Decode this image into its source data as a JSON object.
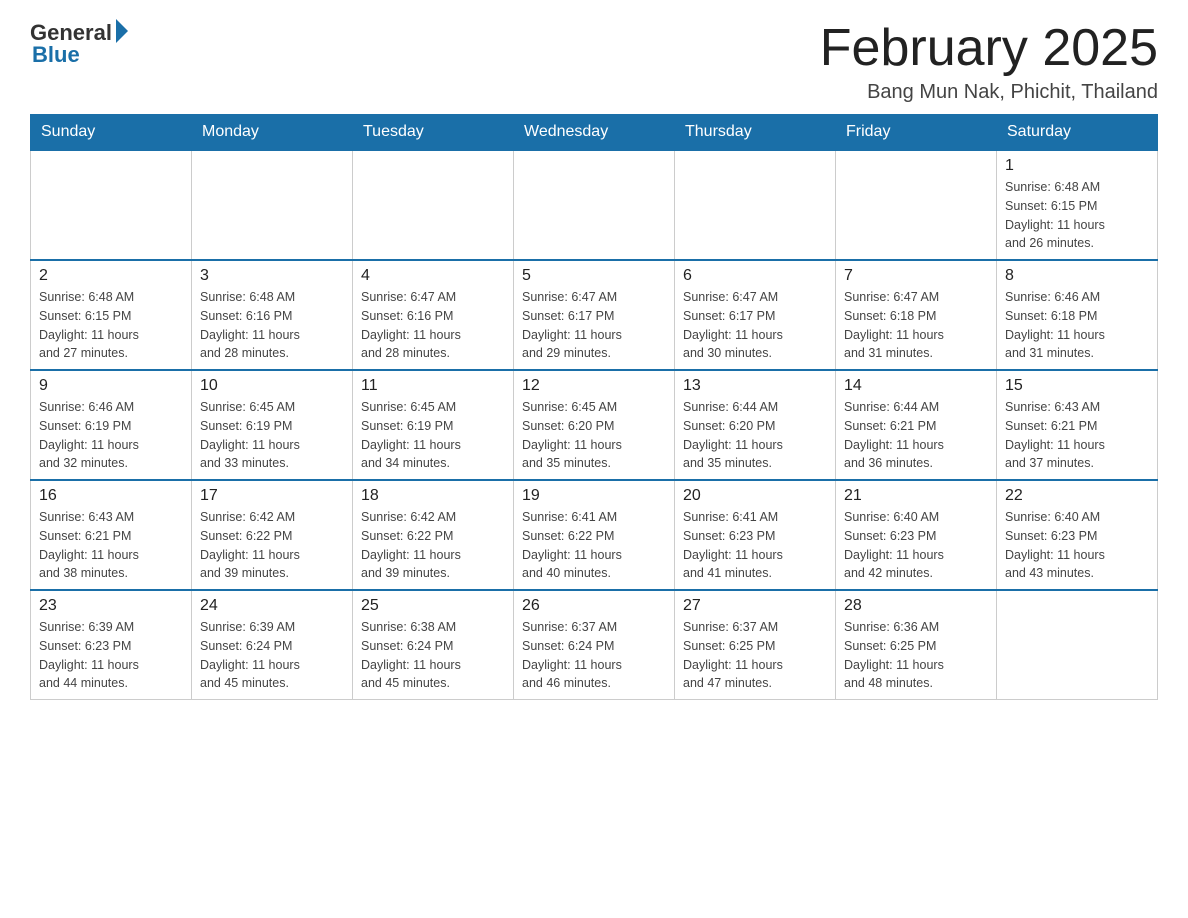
{
  "header": {
    "logo_general": "General",
    "logo_blue": "Blue",
    "title": "February 2025",
    "subtitle": "Bang Mun Nak, Phichit, Thailand"
  },
  "days_of_week": [
    "Sunday",
    "Monday",
    "Tuesday",
    "Wednesday",
    "Thursday",
    "Friday",
    "Saturday"
  ],
  "weeks": [
    [
      {
        "day": "",
        "info": ""
      },
      {
        "day": "",
        "info": ""
      },
      {
        "day": "",
        "info": ""
      },
      {
        "day": "",
        "info": ""
      },
      {
        "day": "",
        "info": ""
      },
      {
        "day": "",
        "info": ""
      },
      {
        "day": "1",
        "info": "Sunrise: 6:48 AM\nSunset: 6:15 PM\nDaylight: 11 hours\nand 26 minutes."
      }
    ],
    [
      {
        "day": "2",
        "info": "Sunrise: 6:48 AM\nSunset: 6:15 PM\nDaylight: 11 hours\nand 27 minutes."
      },
      {
        "day": "3",
        "info": "Sunrise: 6:48 AM\nSunset: 6:16 PM\nDaylight: 11 hours\nand 28 minutes."
      },
      {
        "day": "4",
        "info": "Sunrise: 6:47 AM\nSunset: 6:16 PM\nDaylight: 11 hours\nand 28 minutes."
      },
      {
        "day": "5",
        "info": "Sunrise: 6:47 AM\nSunset: 6:17 PM\nDaylight: 11 hours\nand 29 minutes."
      },
      {
        "day": "6",
        "info": "Sunrise: 6:47 AM\nSunset: 6:17 PM\nDaylight: 11 hours\nand 30 minutes."
      },
      {
        "day": "7",
        "info": "Sunrise: 6:47 AM\nSunset: 6:18 PM\nDaylight: 11 hours\nand 31 minutes."
      },
      {
        "day": "8",
        "info": "Sunrise: 6:46 AM\nSunset: 6:18 PM\nDaylight: 11 hours\nand 31 minutes."
      }
    ],
    [
      {
        "day": "9",
        "info": "Sunrise: 6:46 AM\nSunset: 6:19 PM\nDaylight: 11 hours\nand 32 minutes."
      },
      {
        "day": "10",
        "info": "Sunrise: 6:45 AM\nSunset: 6:19 PM\nDaylight: 11 hours\nand 33 minutes."
      },
      {
        "day": "11",
        "info": "Sunrise: 6:45 AM\nSunset: 6:19 PM\nDaylight: 11 hours\nand 34 minutes."
      },
      {
        "day": "12",
        "info": "Sunrise: 6:45 AM\nSunset: 6:20 PM\nDaylight: 11 hours\nand 35 minutes."
      },
      {
        "day": "13",
        "info": "Sunrise: 6:44 AM\nSunset: 6:20 PM\nDaylight: 11 hours\nand 35 minutes."
      },
      {
        "day": "14",
        "info": "Sunrise: 6:44 AM\nSunset: 6:21 PM\nDaylight: 11 hours\nand 36 minutes."
      },
      {
        "day": "15",
        "info": "Sunrise: 6:43 AM\nSunset: 6:21 PM\nDaylight: 11 hours\nand 37 minutes."
      }
    ],
    [
      {
        "day": "16",
        "info": "Sunrise: 6:43 AM\nSunset: 6:21 PM\nDaylight: 11 hours\nand 38 minutes."
      },
      {
        "day": "17",
        "info": "Sunrise: 6:42 AM\nSunset: 6:22 PM\nDaylight: 11 hours\nand 39 minutes."
      },
      {
        "day": "18",
        "info": "Sunrise: 6:42 AM\nSunset: 6:22 PM\nDaylight: 11 hours\nand 39 minutes."
      },
      {
        "day": "19",
        "info": "Sunrise: 6:41 AM\nSunset: 6:22 PM\nDaylight: 11 hours\nand 40 minutes."
      },
      {
        "day": "20",
        "info": "Sunrise: 6:41 AM\nSunset: 6:23 PM\nDaylight: 11 hours\nand 41 minutes."
      },
      {
        "day": "21",
        "info": "Sunrise: 6:40 AM\nSunset: 6:23 PM\nDaylight: 11 hours\nand 42 minutes."
      },
      {
        "day": "22",
        "info": "Sunrise: 6:40 AM\nSunset: 6:23 PM\nDaylight: 11 hours\nand 43 minutes."
      }
    ],
    [
      {
        "day": "23",
        "info": "Sunrise: 6:39 AM\nSunset: 6:23 PM\nDaylight: 11 hours\nand 44 minutes."
      },
      {
        "day": "24",
        "info": "Sunrise: 6:39 AM\nSunset: 6:24 PM\nDaylight: 11 hours\nand 45 minutes."
      },
      {
        "day": "25",
        "info": "Sunrise: 6:38 AM\nSunset: 6:24 PM\nDaylight: 11 hours\nand 45 minutes."
      },
      {
        "day": "26",
        "info": "Sunrise: 6:37 AM\nSunset: 6:24 PM\nDaylight: 11 hours\nand 46 minutes."
      },
      {
        "day": "27",
        "info": "Sunrise: 6:37 AM\nSunset: 6:25 PM\nDaylight: 11 hours\nand 47 minutes."
      },
      {
        "day": "28",
        "info": "Sunrise: 6:36 AM\nSunset: 6:25 PM\nDaylight: 11 hours\nand 48 minutes."
      },
      {
        "day": "",
        "info": ""
      }
    ]
  ]
}
